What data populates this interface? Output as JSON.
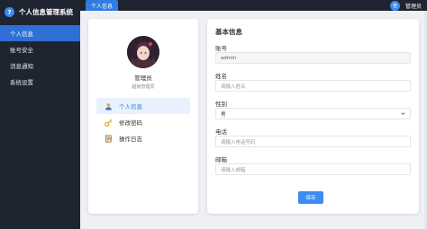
{
  "app": {
    "logo_glyph": "?",
    "title": "个人信息管理系统"
  },
  "sidebar": {
    "items": [
      {
        "label": "个人信息",
        "active": true
      },
      {
        "label": "账号安全",
        "active": false
      },
      {
        "label": "消息通知",
        "active": false
      },
      {
        "label": "系统设置",
        "active": false
      }
    ]
  },
  "topbar": {
    "tab_label": "个人信息",
    "avatar_glyph": "管",
    "username": "管理员"
  },
  "profile": {
    "name": "管理员",
    "role": "超级管理员",
    "menu": [
      {
        "label": "个人信息",
        "icon": "user-icon",
        "active": true
      },
      {
        "label": "修改密码",
        "icon": "key-icon",
        "active": false
      },
      {
        "label": "操作日志",
        "icon": "log-icon",
        "active": false
      }
    ]
  },
  "form": {
    "title": "基本信息",
    "account_label": "账号",
    "account_value": "admin",
    "name_label": "姓名",
    "name_placeholder": "请输入姓名",
    "gender_label": "性别",
    "gender_value": "男",
    "phone_label": "电话",
    "phone_placeholder": "请输入电话号码",
    "email_label": "邮箱",
    "email_placeholder": "请输入邮箱",
    "save_label": "保存"
  },
  "colors": {
    "accent": "#3d8cf0",
    "sidebar_bg": "#1f2431",
    "sidebar_active": "#2f6fd6"
  }
}
